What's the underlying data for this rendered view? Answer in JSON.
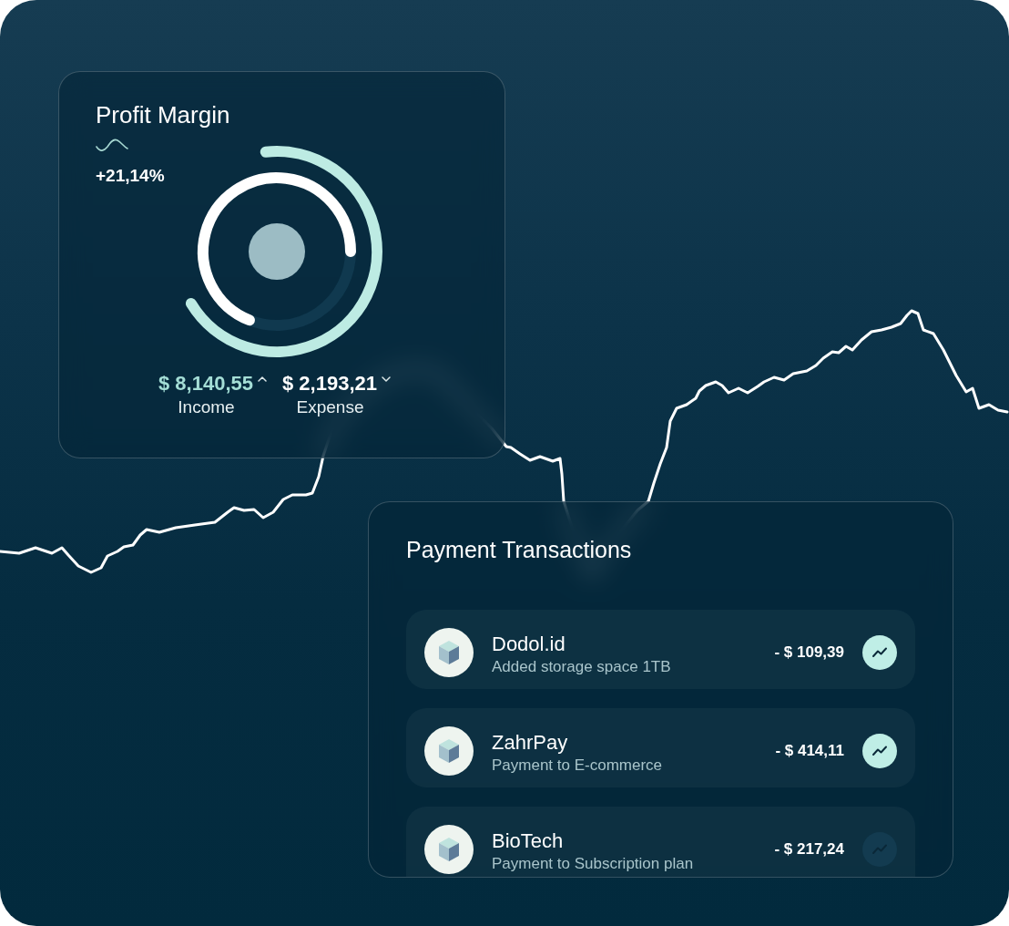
{
  "profit_card": {
    "title": "Profit Margin",
    "change": "+21,14%",
    "summary": [
      {
        "kind": "income",
        "amount": "$ 8,140,55",
        "label": "Income"
      },
      {
        "kind": "expense",
        "amount": "$ 2,193,21",
        "label": "Expense"
      }
    ]
  },
  "payments_card": {
    "title": "Payment Transactions",
    "transactions": [
      {
        "name": "Dodol.id",
        "description": "Added storage space 1TB",
        "amount": "- $ 109,39",
        "trend_highlighted": true
      },
      {
        "name": "ZahrPay",
        "description": "Payment to E-commerce",
        "amount": "- $ 414,11",
        "trend_highlighted": true
      },
      {
        "name": "BioTech",
        "description": "Payment to Subscription plan",
        "amount": "- $ 217,24",
        "trend_highlighted": false
      }
    ]
  }
}
